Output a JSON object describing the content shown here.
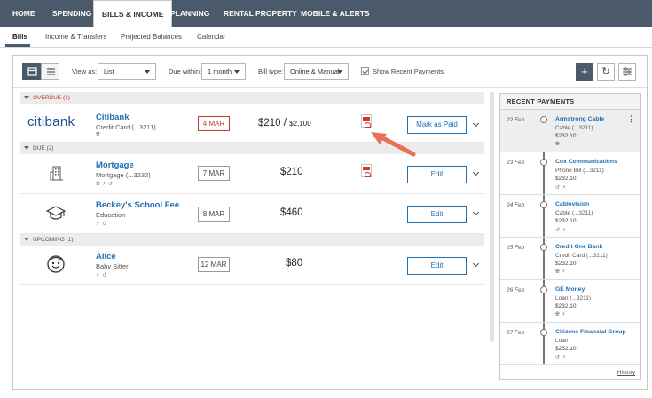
{
  "top_nav": {
    "tabs": [
      {
        "label": "HOME"
      },
      {
        "label": "SPENDING"
      },
      {
        "label": "BILLS & INCOME",
        "active": true
      },
      {
        "label": "PLANNING"
      },
      {
        "label": "RENTAL PROPERTY"
      },
      {
        "label": "MOBILE & ALERTS"
      }
    ]
  },
  "sub_nav": {
    "tabs": [
      {
        "label": "Bills",
        "active": true
      },
      {
        "label": "Income & Transfers"
      },
      {
        "label": "Projected Balances"
      },
      {
        "label": "Calendar"
      }
    ]
  },
  "toolbar": {
    "view_as_label": "View as:",
    "view_as_value": "List",
    "due_within_label": "Due within:",
    "due_within_value": "1 month",
    "bill_type_label": "Bill type:",
    "bill_type_value": "Online & Manual",
    "show_recent_label": "Show Recent Payments",
    "show_recent_checked": true,
    "add_icon": "plus-icon",
    "refresh_icon": "refresh-icon",
    "settings_icon": "sliders-icon"
  },
  "sections": [
    {
      "title": "OVERDUE (1)",
      "color": "#c0392b"
    },
    {
      "title": "DUE (2)"
    },
    {
      "title": "UPCOMING (1)"
    }
  ],
  "bills": [
    {
      "logo_text": "citibank",
      "name": "Citibank",
      "sub": "Credit Card (...3211)",
      "icons": "globe-icon",
      "date": "4 MAR",
      "amount": "$210",
      "amount_sep": "/",
      "amount_total": "$2,100",
      "has_pdf": true,
      "action": "Mark as Paid",
      "overdue": true
    },
    {
      "logo_icon": "building-icon",
      "name": "Mortgage",
      "sub": "Mortgage (...3232)",
      "icons": "globe-icon bolt-icon repeat-icon",
      "date": "7 MAR",
      "amount": "$210",
      "has_pdf": true,
      "action": "Edit"
    },
    {
      "logo_icon": "graduation-cap-icon",
      "name": "Beckey's School Fee",
      "sub": "Education",
      "icons": "bolt-icon repeat-icon",
      "date": "8 MAR",
      "amount": "$460",
      "action": "Edit"
    },
    {
      "logo_icon": "smiley-face-icon",
      "name": "Alice",
      "sub": "Baby Sitter",
      "icons": "bolt-icon repeat-icon",
      "date": "12 MAR",
      "amount": "$80",
      "action": "Edit"
    }
  ],
  "recent_payments": {
    "title": "RECENT PAYMENTS",
    "items": [
      {
        "date": "22 Feb",
        "name": "Armstrong Cable",
        "sub": "Cable (...3211)",
        "amount": "$232.10",
        "icons": "globe-icon"
      },
      {
        "date": "23 Feb",
        "name": "Cox Communications",
        "sub": "Phone Bill (...3211)",
        "amount": "$232.10",
        "icons": "repeat-icon bolt-icon"
      },
      {
        "date": "24 Feb",
        "name": "Cablevision",
        "sub": "Cable (...3211)",
        "amount": "$232.10",
        "icons": "repeat-icon bolt-icon"
      },
      {
        "date": "25 Feb",
        "name": "Credit One Bank",
        "sub": "Credit Card (...3211)",
        "amount": "$232.10",
        "icons": "globe-icon bolt-icon"
      },
      {
        "date": "26 Feb",
        "name": "GE Money",
        "sub": "Loan (...3211)",
        "amount": "$232.10",
        "icons": "globe-icon bolt-icon"
      },
      {
        "date": "27 Feb",
        "name": "Citizens Financial Group",
        "sub": "Loan",
        "amount": "$232.10",
        "icons": "repeat-icon bolt-icon"
      }
    ],
    "history_label": "History"
  },
  "colors": {
    "nav_bg": "#4a5a6a",
    "link_blue": "#1e6fb5",
    "overdue_red": "#c0392b",
    "arrow": "#e8715a"
  }
}
